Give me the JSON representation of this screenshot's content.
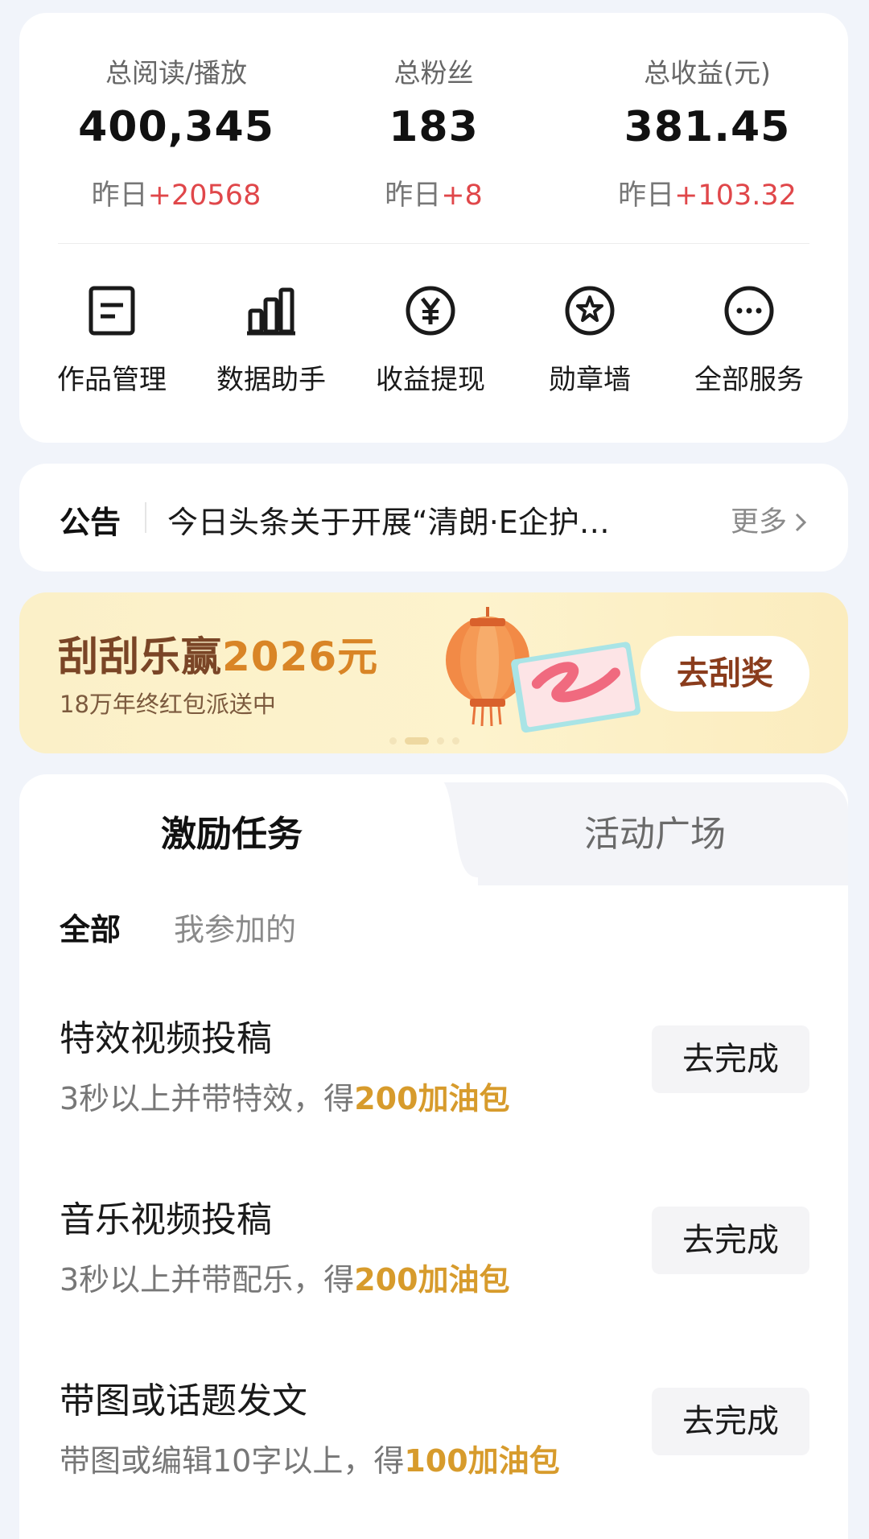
{
  "stats": [
    {
      "label": "总阅读/播放",
      "value": "400,345",
      "delta_prefix": "昨日",
      "delta": "+20568"
    },
    {
      "label": "总粉丝",
      "value": "183",
      "delta_prefix": "昨日",
      "delta": "+8"
    },
    {
      "label": "总收益(元)",
      "value": "381.45",
      "delta_prefix": "昨日",
      "delta": "+103.32"
    }
  ],
  "services": [
    {
      "label": "作品管理",
      "icon": "document-icon"
    },
    {
      "label": "数据助手",
      "icon": "bar-chart-icon"
    },
    {
      "label": "收益提现",
      "icon": "yuan-icon"
    },
    {
      "label": "勋章墙",
      "icon": "medal-icon"
    },
    {
      "label": "全部服务",
      "icon": "more-icon"
    }
  ],
  "notice": {
    "title": "公告",
    "text": "今日头条关于开展“清朗·E企护…",
    "more": "更多"
  },
  "banner": {
    "title_main": "刮刮乐赢",
    "title_amount": "2026元",
    "subtitle": "18万年终红包派送中",
    "button": "去刮奖"
  },
  "tabs": {
    "active": "激励任务",
    "inactive": "活动广场"
  },
  "filters": {
    "all": "全部",
    "mine": "我参加的"
  },
  "tasks": [
    {
      "title": "特效视频投稿",
      "desc": "3秒以上并带特效，得",
      "reward": "200加油包",
      "button": "去完成"
    },
    {
      "title": "音乐视频投稿",
      "desc": "3秒以上并带配乐，得",
      "reward": "200加油包",
      "button": "去完成"
    },
    {
      "title": "带图或话题发文",
      "desc": "带图或编辑10字以上，得",
      "reward": "100加油包",
      "button": "去完成"
    }
  ],
  "colors": {
    "accent_red": "#e0474a",
    "reward_gold": "#d79b2c",
    "banner_brown": "#7a4526"
  }
}
